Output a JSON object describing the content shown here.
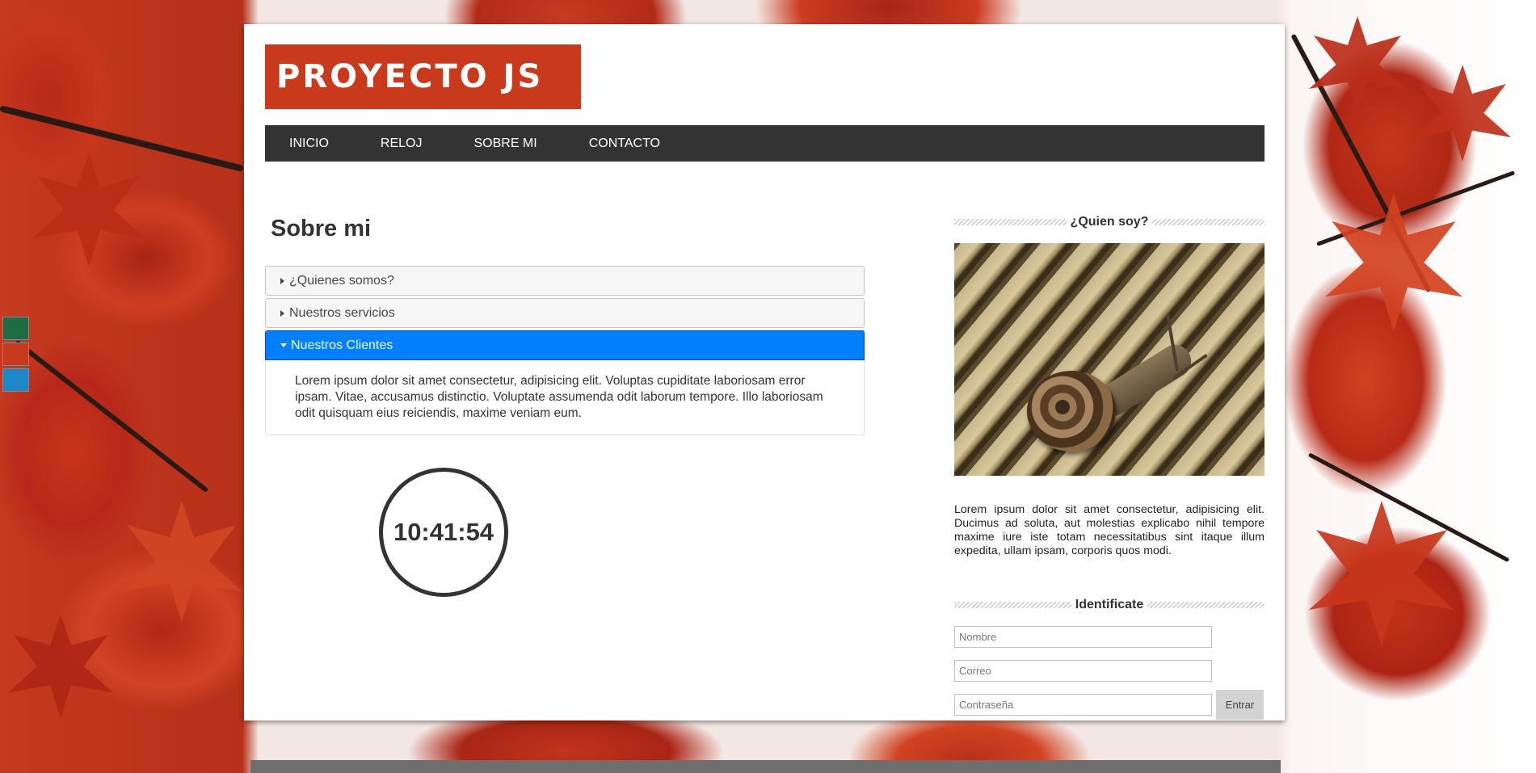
{
  "logo": {
    "text": "PROYECTO JS"
  },
  "nav": {
    "items": [
      {
        "label": "INICIO"
      },
      {
        "label": "RELOJ"
      },
      {
        "label": "SOBRE MI"
      },
      {
        "label": "CONTACTO"
      }
    ]
  },
  "main": {
    "title": "Sobre mi",
    "accordion": [
      {
        "label": "¿Quienes somos?",
        "expanded": false
      },
      {
        "label": "Nuestros servicios",
        "expanded": false
      },
      {
        "label": "Nuestros Clientes",
        "expanded": true,
        "content": "Lorem ipsum dolor sit amet consectetur, adipisicing elit. Voluptas cupiditate laboriosam error ipsam. Vitae, accusamus distinctio. Voluptate assumenda odit laborum tempore. Illo laboriosam odit quisquam eius reiciendis, maxime veniam eum."
      }
    ],
    "clock": "10:41:54"
  },
  "sidebar": {
    "about_title": "¿Quien soy?",
    "about_text": "Lorem ipsum dolor sit amet consectetur, adipisicing elit. Ducimus ad soluta, aut molestias explicabo nihil tempore maxime iure iste totam necessitatibus sint itaque illum expedita, ullam ipsam, corporis quos modi.",
    "login_title": "Identificate",
    "login": {
      "name_placeholder": "Nombre",
      "email_placeholder": "Correo",
      "password_placeholder": "Contraseña",
      "submit_label": "Entrar"
    }
  },
  "theme_swatches": [
    {
      "color": "#1f6b42"
    },
    {
      "color": "#c9391c"
    },
    {
      "color": "#1e87c9"
    }
  ],
  "colors": {
    "brand": "#c9391c",
    "nav_bg": "#333333",
    "accordion_active": "#007fff"
  }
}
